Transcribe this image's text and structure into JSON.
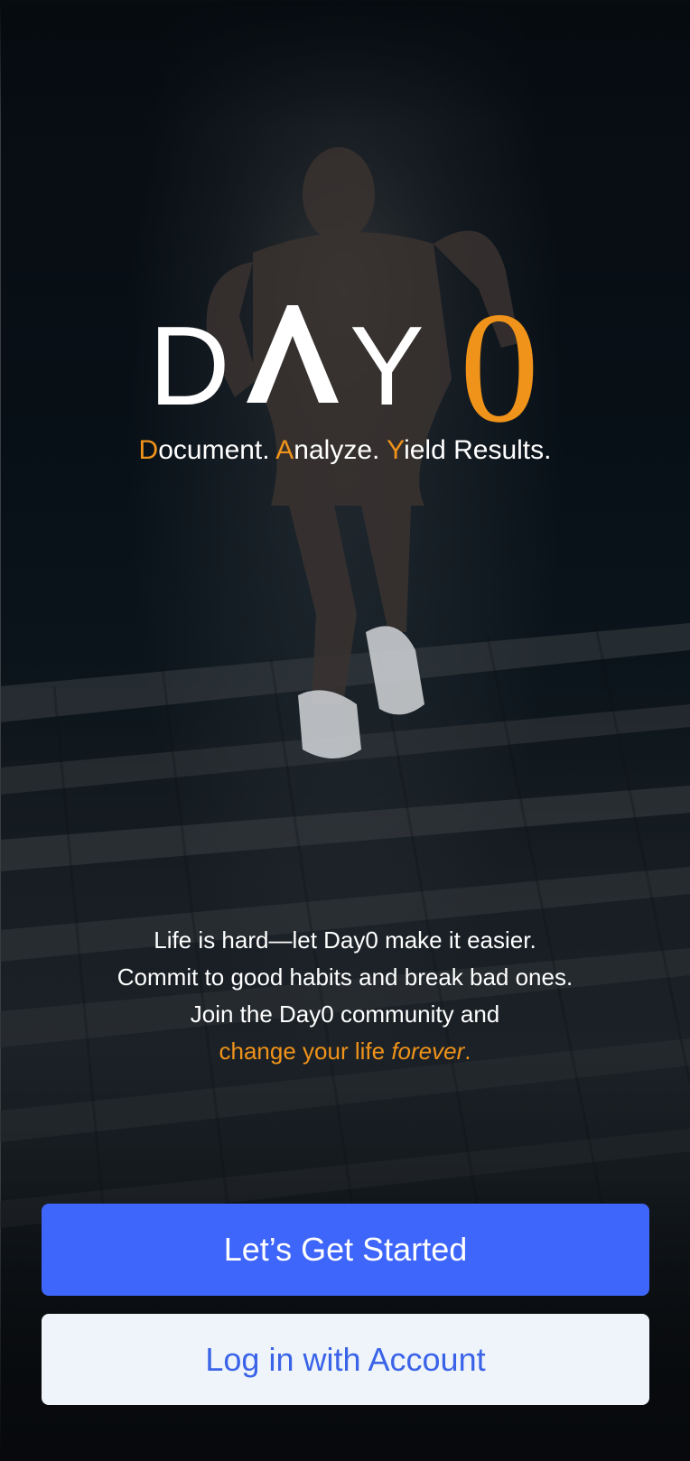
{
  "brand": {
    "logo_letters": [
      "D",
      "Y"
    ],
    "logo_zero": "0",
    "accent_color": "#f0931a",
    "tagline": [
      {
        "initial": "D",
        "rest": "ocument. "
      },
      {
        "initial": "A",
        "rest": "nalyze. "
      },
      {
        "initial": "Y",
        "rest": "ield Results."
      }
    ]
  },
  "pitch": {
    "lines": [
      "Life is hard—let Day0 make it easier.",
      "Commit to good habits and break bad ones.",
      "Join the Day0 community and"
    ],
    "highlight_prefix": "change your life ",
    "highlight_emphasis": "forever",
    "highlight_suffix": "."
  },
  "actions": {
    "primary_label": "Let’s Get Started",
    "primary_color": "#3e66fa",
    "secondary_label": "Log in with Account",
    "secondary_color": "#eef4fa"
  },
  "icons": {
    "logo": "day0-logo",
    "background": "runner-photo"
  }
}
